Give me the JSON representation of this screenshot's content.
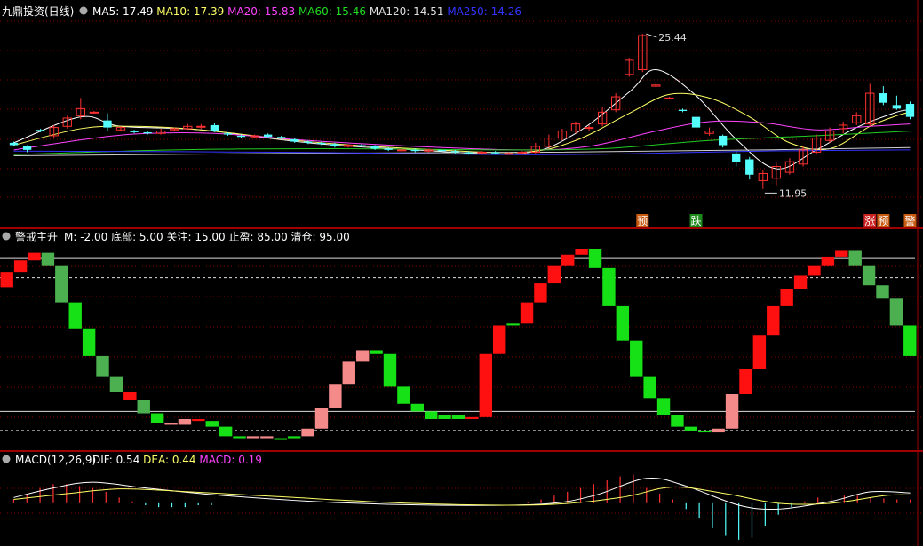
{
  "colors": {
    "up": "#ff3030",
    "down": "#54ffff",
    "ma5": "#ffffff",
    "ma10": "#ffff66",
    "ma20": "#ff44ff",
    "ma60": "#22cc22",
    "ma120": "#d0d0d0",
    "ma250": "#3333ff",
    "grid": "#8a0000",
    "sep": "#a00000",
    "salmon": "#f58a8a",
    "green": "#16e016",
    "darkgreen": "#4caf50",
    "red": "#ff1010",
    "dif": "#ffffff",
    "dea": "#ffff66"
  },
  "panel1": {
    "title": "九鼎投资(日线)",
    "indicators": [
      {
        "name": "MA5",
        "label": "MA5:",
        "value": "17.49",
        "color": "#ffffff"
      },
      {
        "name": "MA10",
        "label": "MA10:",
        "value": "17.39",
        "color": "#ffff66"
      },
      {
        "name": "MA20",
        "label": "MA20:",
        "value": "15.83",
        "color": "#ff44ff"
      },
      {
        "name": "MA60",
        "label": "MA60:",
        "value": "15.46",
        "color": "#22dd22"
      },
      {
        "name": "MA120",
        "label": "MA120:",
        "value": "14.51",
        "color": "#e0e0e0"
      },
      {
        "name": "MA250",
        "label": "MA250:",
        "value": "14.26",
        "color": "#3333ff"
      }
    ],
    "high_label": "25.44",
    "low_label": "11.95",
    "badges": [
      {
        "text": "预",
        "bg": "#c85a10",
        "fg": "#ffffff"
      },
      {
        "text": "跌",
        "bg": "#1d8a1d",
        "fg": "#ffffff"
      },
      {
        "text": "涨",
        "bg": "#cc2222",
        "fg": "#ffffff"
      },
      {
        "text": "预",
        "bg": "#c85a10",
        "fg": "#ffffff"
      },
      {
        "text": "警",
        "bg": "#c85a10",
        "fg": "#ffffff"
      }
    ]
  },
  "panel2": {
    "title": "警戒主升",
    "values": [
      {
        "label": "M:",
        "value": "-2.00"
      },
      {
        "label": "底部:",
        "value": "5.00"
      },
      {
        "label": "关注:",
        "value": "15.00"
      },
      {
        "label": "止盈:",
        "value": "85.00"
      },
      {
        "label": "清仓:",
        "value": "95.00"
      }
    ]
  },
  "panel3": {
    "title": "MACD(12,26,9)",
    "values": [
      {
        "label": "DIF:",
        "value": "0.54",
        "color": "#ffffff"
      },
      {
        "label": "DEA:",
        "value": "0.44",
        "color": "#ffff66"
      },
      {
        "label": "MACD:",
        "value": "0.19",
        "color": "#ff44ff"
      }
    ]
  },
  "chart_data": [
    {
      "type": "candlestick",
      "title": "九鼎投资(日线)",
      "n_bars": 68,
      "ylim": [
        11.0,
        26.5
      ],
      "candles": [
        [
          16.2,
          16.0,
          16.3,
          15.9
        ],
        [
          15.9,
          15.6,
          16.0,
          15.4
        ],
        [
          17.3,
          17.2,
          17.4,
          17.1
        ],
        [
          16.8,
          17.5,
          17.7,
          16.6
        ],
        [
          17.6,
          18.3,
          18.5,
          17.4
        ],
        [
          18.5,
          19.1,
          20.0,
          18.2
        ],
        [
          18.8,
          18.8,
          18.9,
          18.7
        ],
        [
          18.1,
          17.5,
          18.7,
          17.2
        ],
        [
          17.3,
          17.5,
          17.6,
          17.2
        ],
        [
          17.2,
          17.1,
          17.3,
          17.0
        ],
        [
          17.1,
          17.0,
          17.2,
          16.9
        ],
        [
          17.0,
          17.2,
          17.4,
          16.9
        ],
        [
          17.3,
          17.4,
          17.5,
          17.2
        ],
        [
          17.4,
          17.6,
          17.8,
          17.3
        ],
        [
          17.6,
          17.6,
          17.8,
          17.4
        ],
        [
          17.7,
          17.2,
          17.9,
          17.1
        ],
        [
          17.0,
          16.9,
          17.1,
          16.8
        ],
        [
          16.8,
          16.7,
          16.9,
          16.6
        ],
        [
          16.7,
          16.8,
          16.9,
          16.6
        ],
        [
          16.9,
          16.7,
          17.0,
          16.6
        ],
        [
          16.7,
          16.6,
          16.8,
          16.5
        ],
        [
          16.5,
          16.3,
          16.6,
          16.2
        ],
        [
          16.3,
          16.2,
          16.4,
          16.1
        ],
        [
          16.2,
          16.1,
          16.3,
          16.0
        ],
        [
          16.1,
          15.9,
          16.2,
          15.8
        ],
        [
          15.9,
          16.0,
          16.1,
          15.8
        ],
        [
          16.0,
          15.9,
          16.1,
          15.8
        ],
        [
          15.9,
          15.7,
          16.0,
          15.6
        ],
        [
          15.7,
          15.6,
          15.8,
          15.5
        ],
        [
          15.6,
          15.6,
          15.7,
          15.5
        ],
        [
          15.6,
          15.5,
          15.7,
          15.4
        ],
        [
          15.5,
          15.6,
          15.7,
          15.4
        ],
        [
          15.6,
          15.5,
          15.7,
          15.4
        ],
        [
          15.5,
          15.4,
          15.6,
          15.3
        ],
        [
          15.4,
          15.3,
          15.5,
          15.2
        ],
        [
          15.3,
          15.4,
          15.5,
          15.2
        ],
        [
          15.4,
          15.3,
          15.5,
          15.2
        ],
        [
          15.3,
          15.3,
          15.4,
          15.2
        ],
        [
          15.3,
          15.4,
          15.5,
          15.2
        ],
        [
          15.4,
          15.9,
          16.2,
          15.3
        ],
        [
          15.9,
          16.6,
          16.9,
          15.8
        ],
        [
          16.6,
          17.2,
          17.4,
          16.4
        ],
        [
          17.2,
          17.8,
          18.0,
          17.0
        ],
        [
          17.5,
          17.5,
          17.7,
          17.2
        ],
        [
          17.8,
          18.8,
          19.2,
          17.6
        ],
        [
          19.0,
          20.1,
          20.4,
          18.8
        ],
        [
          22.0,
          23.2,
          23.4,
          21.8
        ],
        [
          22.4,
          25.3,
          25.44,
          22.2
        ],
        [
          21.0,
          21.1,
          21.3,
          20.9
        ],
        [
          20.0,
          20.0,
          20.1,
          19.9
        ],
        [
          19.0,
          18.9,
          19.1,
          18.8
        ],
        [
          18.4,
          17.5,
          18.6,
          17.2
        ],
        [
          17.0,
          17.2,
          17.5,
          16.8
        ],
        [
          16.8,
          16.0,
          16.9,
          15.8
        ],
        [
          15.3,
          14.6,
          15.5,
          14.2
        ],
        [
          14.8,
          13.5,
          15.0,
          13.1
        ],
        [
          13.0,
          13.6,
          13.9,
          12.3
        ],
        [
          13.2,
          14.2,
          14.5,
          12.6
        ],
        [
          13.7,
          14.6,
          14.9,
          13.5
        ],
        [
          14.4,
          15.6,
          15.9,
          14.2
        ],
        [
          15.4,
          16.6,
          16.9,
          15.2
        ],
        [
          16.4,
          17.2,
          17.5,
          16.2
        ],
        [
          17.4,
          17.7,
          18.0,
          17.0
        ],
        [
          17.9,
          18.5,
          18.8,
          17.7
        ],
        [
          17.8,
          20.4,
          21.2,
          17.6
        ],
        [
          20.4,
          19.6,
          21.0,
          19.4
        ],
        [
          19.4,
          19.1,
          20.2,
          19.0
        ],
        [
          19.5,
          18.4,
          19.7,
          18.2
        ]
      ],
      "ma_series": {
        "MA5": [
          [
            0,
            16.2
          ],
          [
            5,
            18.4
          ],
          [
            8,
            17.6
          ],
          [
            14,
            17.3
          ],
          [
            22,
            16.2
          ],
          [
            30,
            15.6
          ],
          [
            38,
            15.3
          ],
          [
            42,
            17.0
          ],
          [
            46,
            20.5
          ],
          [
            48,
            22.4
          ],
          [
            51,
            20.2
          ],
          [
            54,
            16.5
          ],
          [
            57,
            14.0
          ],
          [
            60,
            15.6
          ],
          [
            63,
            17.5
          ],
          [
            66,
            18.8
          ],
          [
            67,
            19.0
          ]
        ],
        "MA10": [
          [
            0,
            16.0
          ],
          [
            5,
            17.4
          ],
          [
            9,
            17.6
          ],
          [
            14,
            17.3
          ],
          [
            22,
            16.3
          ],
          [
            30,
            15.7
          ],
          [
            38,
            15.4
          ],
          [
            42,
            16.4
          ],
          [
            46,
            18.7
          ],
          [
            49,
            20.3
          ],
          [
            52,
            20.0
          ],
          [
            55,
            18.4
          ],
          [
            58,
            16.2
          ],
          [
            61,
            15.7
          ],
          [
            64,
            17.6
          ],
          [
            66,
            18.5
          ],
          [
            67,
            18.8
          ]
        ],
        "MA20": [
          [
            0,
            15.6
          ],
          [
            6,
            16.6
          ],
          [
            10,
            17.0
          ],
          [
            15,
            17.0
          ],
          [
            22,
            16.4
          ],
          [
            30,
            15.9
          ],
          [
            38,
            15.6
          ],
          [
            43,
            15.9
          ],
          [
            48,
            17.2
          ],
          [
            52,
            18.0
          ],
          [
            56,
            17.9
          ],
          [
            60,
            17.3
          ],
          [
            64,
            17.6
          ],
          [
            67,
            17.8
          ]
        ],
        "MA60": [
          [
            0,
            15.2
          ],
          [
            12,
            15.6
          ],
          [
            24,
            15.7
          ],
          [
            36,
            15.6
          ],
          [
            44,
            15.7
          ],
          [
            52,
            16.4
          ],
          [
            60,
            16.8
          ],
          [
            67,
            17.2
          ]
        ],
        "MA120": [
          [
            0,
            15.1
          ],
          [
            20,
            15.3
          ],
          [
            40,
            15.4
          ],
          [
            56,
            15.6
          ],
          [
            67,
            15.8
          ]
        ],
        "MA250": [
          [
            0,
            15.5
          ],
          [
            20,
            15.4
          ],
          [
            40,
            15.2
          ],
          [
            56,
            15.5
          ],
          [
            67,
            15.6
          ]
        ]
      },
      "high_marker": {
        "index": 47,
        "price": 25.44
      },
      "low_marker": {
        "index": 56,
        "price": 11.95
      },
      "badge_indices": [
        47,
        51,
        64,
        65,
        67
      ]
    },
    {
      "type": "bar",
      "title": "警戒主升",
      "ylim": [
        -2,
        102
      ],
      "reference_lines": [
        5,
        15,
        85,
        95
      ],
      "bars": [
        [
          80,
          88,
          "red"
        ],
        [
          88,
          94,
          "red"
        ],
        [
          94,
          98,
          "red"
        ],
        [
          98,
          91,
          "darkgreen"
        ],
        [
          91,
          72,
          "darkgreen"
        ],
        [
          72,
          58,
          "green"
        ],
        [
          58,
          44,
          "green"
        ],
        [
          44,
          33,
          "darkgreen"
        ],
        [
          33,
          25,
          "darkgreen"
        ],
        [
          25,
          21,
          "red"
        ],
        [
          21,
          14,
          "darkgreen"
        ],
        [
          14,
          9,
          "green"
        ],
        [
          9,
          8,
          "salmon"
        ],
        [
          8,
          11,
          "salmon"
        ],
        [
          11,
          10,
          "red"
        ],
        [
          10,
          7,
          "green"
        ],
        [
          7,
          2,
          "green"
        ],
        [
          2,
          1,
          "green"
        ],
        [
          1,
          2,
          "salmon"
        ],
        [
          2,
          1,
          "salmon"
        ],
        [
          1,
          1,
          "green"
        ],
        [
          1,
          2,
          "green"
        ],
        [
          2,
          6,
          "salmon"
        ],
        [
          6,
          17,
          "salmon"
        ],
        [
          17,
          29,
          "salmon"
        ],
        [
          29,
          41,
          "salmon"
        ],
        [
          41,
          47,
          "salmon"
        ],
        [
          47,
          45,
          "green"
        ],
        [
          45,
          28,
          "green"
        ],
        [
          28,
          19,
          "green"
        ],
        [
          19,
          15,
          "green"
        ],
        [
          15,
          11,
          "green"
        ],
        [
          11,
          13,
          "green"
        ],
        [
          13,
          11,
          "green"
        ],
        [
          11,
          12,
          "red"
        ],
        [
          12,
          45,
          "red"
        ],
        [
          45,
          60,
          "red"
        ],
        [
          60,
          61,
          "green"
        ],
        [
          61,
          72,
          "red"
        ],
        [
          72,
          82,
          "red"
        ],
        [
          82,
          91,
          "red"
        ],
        [
          91,
          97,
          "red"
        ],
        [
          97,
          100,
          "red"
        ],
        [
          100,
          90,
          "green"
        ],
        [
          90,
          70,
          "green"
        ],
        [
          70,
          52,
          "green"
        ],
        [
          52,
          33,
          "green"
        ],
        [
          33,
          22,
          "green"
        ],
        [
          22,
          13,
          "green"
        ],
        [
          13,
          7,
          "green"
        ],
        [
          7,
          5,
          "green"
        ],
        [
          5,
          4,
          "green"
        ],
        [
          4,
          6,
          "salmon"
        ],
        [
          6,
          24,
          "salmon"
        ],
        [
          24,
          37,
          "red"
        ],
        [
          37,
          55,
          "red"
        ],
        [
          55,
          70,
          "red"
        ],
        [
          70,
          79,
          "red"
        ],
        [
          79,
          86,
          "red"
        ],
        [
          86,
          91,
          "red"
        ],
        [
          91,
          96,
          "red"
        ],
        [
          96,
          99,
          "red"
        ],
        [
          99,
          91,
          "darkgreen"
        ],
        [
          91,
          81,
          "darkgreen"
        ],
        [
          81,
          74,
          "darkgreen"
        ],
        [
          74,
          60,
          "darkgreen"
        ],
        [
          60,
          44,
          "green"
        ]
      ]
    },
    {
      "type": "line",
      "title": "MACD(12,26,9)",
      "ylim": [
        -2.0,
        1.8
      ],
      "dif": [
        [
          0,
          0.3
        ],
        [
          3,
          0.8
        ],
        [
          6,
          1.1
        ],
        [
          10,
          0.8
        ],
        [
          16,
          0.4
        ],
        [
          24,
          0.05
        ],
        [
          32,
          -0.1
        ],
        [
          40,
          -0.05
        ],
        [
          44,
          0.4
        ],
        [
          48,
          1.3
        ],
        [
          51,
          0.9
        ],
        [
          55,
          -0.1
        ],
        [
          58,
          -0.3
        ],
        [
          62,
          0.1
        ],
        [
          65,
          0.6
        ],
        [
          68,
          0.54
        ]
      ],
      "dea": [
        [
          0,
          0.2
        ],
        [
          4,
          0.5
        ],
        [
          8,
          0.75
        ],
        [
          12,
          0.65
        ],
        [
          20,
          0.35
        ],
        [
          30,
          0.0
        ],
        [
          40,
          -0.08
        ],
        [
          46,
          0.3
        ],
        [
          50,
          0.85
        ],
        [
          54,
          0.5
        ],
        [
          58,
          0.0
        ],
        [
          62,
          0.0
        ],
        [
          66,
          0.4
        ],
        [
          68,
          0.44
        ]
      ],
      "macd": [
        0.2,
        0.5,
        0.8,
        1.0,
        1.0,
        0.9,
        0.8,
        0.6,
        0.3,
        0.1,
        -0.1,
        -0.2,
        -0.2,
        -0.2,
        -0.1,
        -0.1,
        0,
        0,
        0,
        0,
        0,
        0,
        0,
        0,
        0,
        0,
        0,
        0,
        0,
        0,
        0,
        0,
        0,
        0,
        0,
        0,
        0,
        0,
        0,
        0.05,
        0.2,
        0.4,
        0.6,
        0.8,
        1.0,
        1.2,
        1.4,
        1.5,
        0.8,
        0.5,
        0.2,
        -0.3,
        -0.8,
        -1.3,
        -1.7,
        -1.9,
        -1.8,
        -1.2,
        -0.6,
        -0.2,
        0.1,
        0.3,
        0.4,
        0.4,
        0.4,
        0.3,
        0.25,
        0.2,
        0.19
      ]
    }
  ]
}
